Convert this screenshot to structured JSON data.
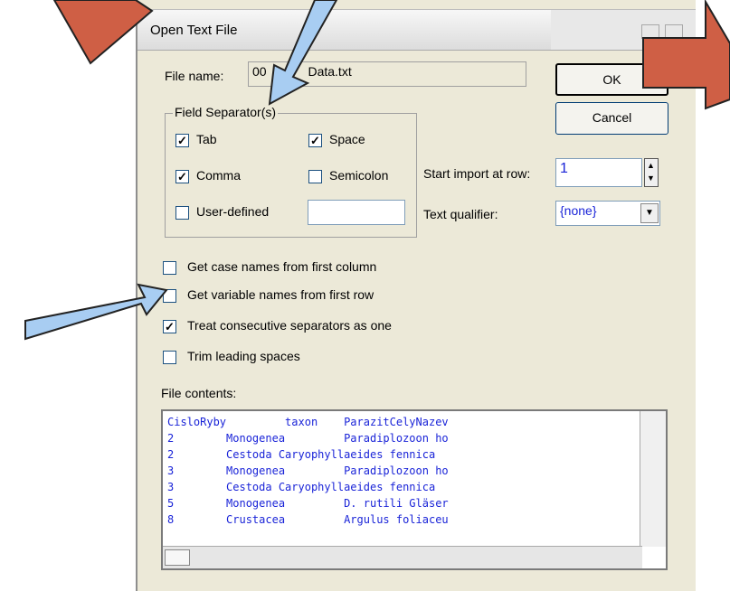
{
  "dialog": {
    "title": "Open Text File",
    "file_name_label": "File name:",
    "file_name_value": "00",
    "file_name_suffix": "Data.txt",
    "ok_label": "OK",
    "cancel_label": "Cancel"
  },
  "separators": {
    "group_title": "Field Separator(s)",
    "tab": {
      "label": "Tab",
      "checked": true
    },
    "space": {
      "label": "Space",
      "checked": true
    },
    "comma": {
      "label": "Comma",
      "checked": true
    },
    "semicolon": {
      "label": "Semicolon",
      "checked": false
    },
    "user_defined": {
      "label": "User-defined",
      "checked": false,
      "value": ""
    }
  },
  "import": {
    "start_row_label": "Start import at row:",
    "start_row_value": "1",
    "qualifier_label": "Text qualifier:",
    "qualifier_value": "{none}"
  },
  "options": [
    {
      "label": "Get case names from first column",
      "checked": false
    },
    {
      "label": "Get variable names from first row",
      "checked": false
    },
    {
      "label": "Treat consecutive separators as one",
      "checked": true
    },
    {
      "label": "Trim leading spaces",
      "checked": false
    }
  ],
  "file_contents": {
    "label": "File contents:",
    "lines": [
      "CisloRyby         taxon    ParazitCelyNazev",
      "2        Monogenea         Paradiplozoon ho",
      "2        Cestoda Caryophyllaeides fennica",
      "3        Monogenea         Paradiplozoon ho",
      "3        Cestoda Caryophyllaeides fennica",
      "5        Monogenea         D. rutili Gläser",
      "8        Crustacea         Argulus foliaceu"
    ]
  },
  "annotations": {
    "arrow_blue": "#a8cdf2",
    "arrow_red": "#cf5f45",
    "arrow_stroke": "#222222"
  },
  "icons": [
    "check-icon",
    "spin-up-icon",
    "spin-down-icon",
    "dropdown-arrow-icon",
    "window-control-icon"
  ]
}
